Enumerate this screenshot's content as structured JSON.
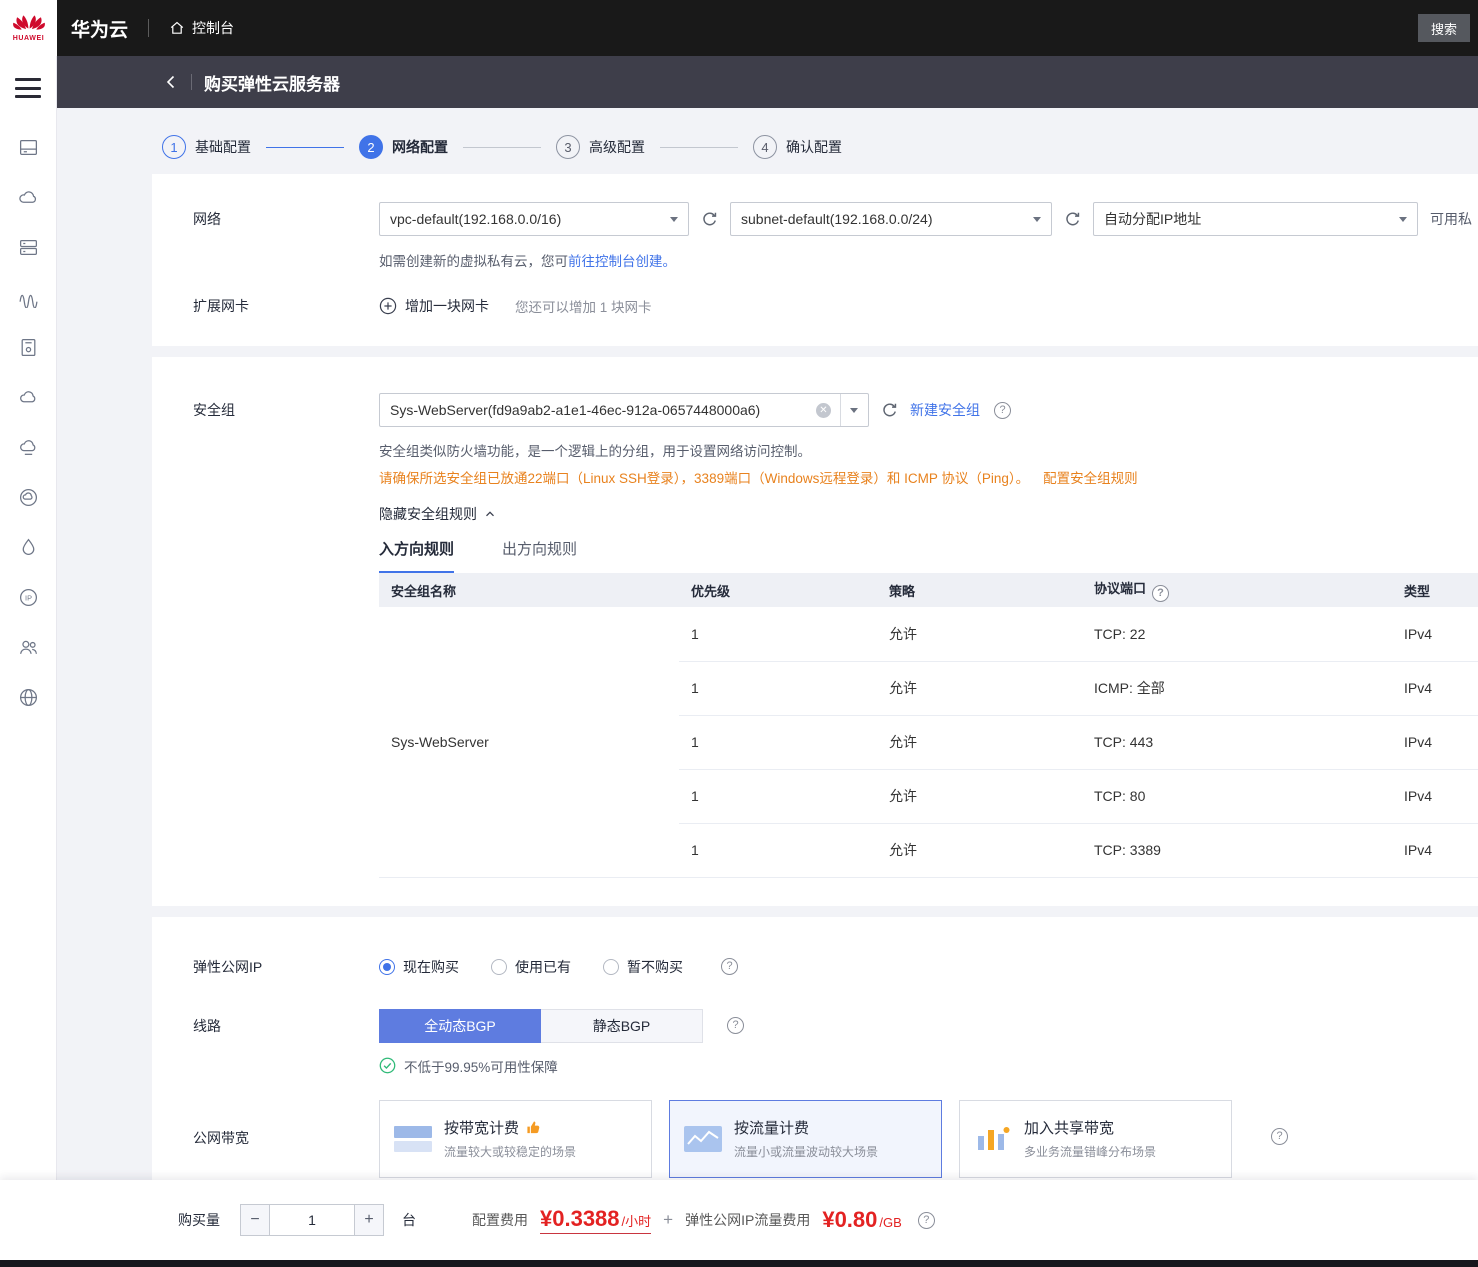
{
  "topbar": {
    "brand": "华为云",
    "console": "控制台",
    "search_label": "搜索",
    "logo_word": "HUAWEI"
  },
  "header": {
    "title": "购买弹性云服务器"
  },
  "steps": [
    {
      "num": "1",
      "label": "基础配置"
    },
    {
      "num": "2",
      "label": "网络配置"
    },
    {
      "num": "3",
      "label": "高级配置"
    },
    {
      "num": "4",
      "label": "确认配置"
    }
  ],
  "sidebar": {
    "icons": [
      "menu-icon",
      "ecs-server-icon",
      "auto-scaling-cloud-icon",
      "storage-stack-icon",
      "network-waves-icon",
      "disk-file-icon",
      "cloud-icon",
      "cloud-service-icon",
      "cloud-monitor-icon",
      "volume-drop-icon",
      "eip-ip-icon",
      "user-group-icon",
      "vpc-globe-icon"
    ]
  },
  "network": {
    "label": "网络",
    "vpc_value": "vpc-default(192.168.0.0/16)",
    "subnet_value": "subnet-default(192.168.0.0/24)",
    "ip_value": "自动分配IP地址",
    "side_note": "可用私",
    "help_prefix": "如需创建新的虚拟私有云，您可",
    "help_link": "前往控制台创建。",
    "nic_label": "扩展网卡",
    "add_nic_label": "增加一块网卡",
    "nic_note": "您还可以增加 1 块网卡"
  },
  "security_group": {
    "label": "安全组",
    "value": "Sys-WebServer(fd9a9ab2-a1e1-46ec-912a-0657448000a6)",
    "new_link": "新建安全组",
    "desc": "安全组类似防火墙功能，是一个逻辑上的分组，用于设置网络访问控制。",
    "warning": "请确保所选安全组已放通22端口（Linux SSH登录），3389端口（Windows远程登录）和 ICMP 协议（Ping）。",
    "warning_link": "配置安全组规则",
    "hide_rules": "隐藏安全组规则",
    "tabs": [
      {
        "label": "入方向规则"
      },
      {
        "label": "出方向规则"
      }
    ],
    "table": {
      "headers": [
        "安全组名称",
        "优先级",
        "策略",
        "协议端口",
        "类型"
      ],
      "group_name": "Sys-WebServer",
      "rows": [
        {
          "priority": "1",
          "policy": "允许",
          "port": "TCP: 22",
          "type": "IPv4"
        },
        {
          "priority": "1",
          "policy": "允许",
          "port": "ICMP: 全部",
          "type": "IPv4"
        },
        {
          "priority": "1",
          "policy": "允许",
          "port": "TCP: 443",
          "type": "IPv4"
        },
        {
          "priority": "1",
          "policy": "允许",
          "port": "TCP: 80",
          "type": "IPv4"
        },
        {
          "priority": "1",
          "policy": "允许",
          "port": "TCP: 3389",
          "type": "IPv4"
        }
      ]
    }
  },
  "eip": {
    "label": "弹性公网IP",
    "options": [
      {
        "label": "现在购买",
        "selected": true
      },
      {
        "label": "使用已有",
        "selected": false
      },
      {
        "label": "暂不购买",
        "selected": false
      }
    ]
  },
  "line": {
    "label": "线路",
    "options": [
      {
        "label": "全动态BGP",
        "selected": true
      },
      {
        "label": "静态BGP",
        "selected": false
      }
    ],
    "guarantee": "不低于99.95%可用性保障"
  },
  "bandwidth": {
    "label": "公网带宽",
    "cards": [
      {
        "title": "按带宽计费",
        "desc": "流量较大或较稳定的场景",
        "recommended": true,
        "selected": false
      },
      {
        "title": "按流量计费",
        "desc": "流量小或流量波动较大场景",
        "recommended": false,
        "selected": true
      },
      {
        "title": "加入共享带宽",
        "desc": "多业务流量错峰分布场景",
        "recommended": false,
        "selected": false
      }
    ]
  },
  "footer": {
    "quantity_label": "购买量",
    "quantity": "1",
    "unit": "台",
    "config_fee_label": "配置费用",
    "config_fee": "¥0.3388",
    "config_fee_unit": "/小时",
    "plus": "+",
    "traffic_fee_label": "弹性公网IP流量费用",
    "traffic_fee": "¥0.80",
    "traffic_fee_unit": "/GB"
  },
  "colors": {
    "accent_blue": "#4073e8",
    "button_blue": "#5e7ce0",
    "warning_orange": "#e8821e",
    "price_red": "#e32222",
    "success_green": "#30ba78",
    "topbar_black": "#191919",
    "titlebar_gray": "#3e3e4a",
    "huawei_red": "#cf0a2c"
  }
}
